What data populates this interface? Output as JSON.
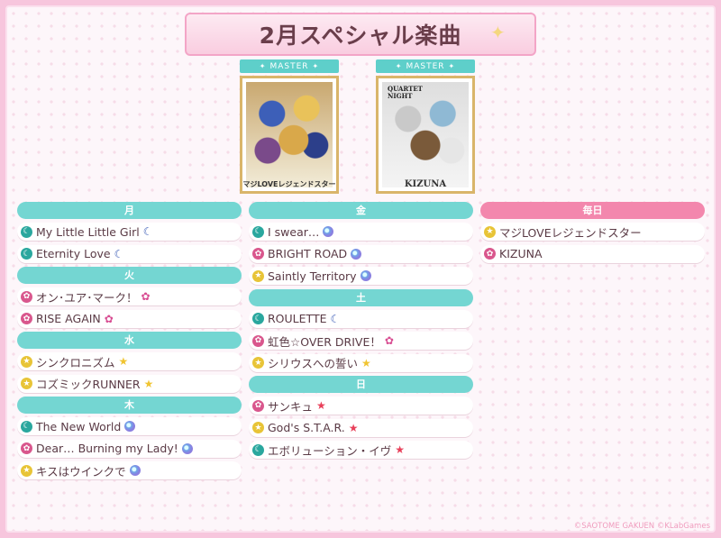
{
  "title": "2月スペシャル楽曲",
  "jackets": [
    {
      "badge": "MASTER",
      "caption": "マジLOVEレジェンドスター"
    },
    {
      "badge": "MASTER",
      "caption": "KIZUNA",
      "logo_line1": "QUARTET",
      "logo_line2": "NIGHT"
    }
  ],
  "columns": [
    {
      "groups": [
        {
          "day": "月",
          "songs": [
            {
              "name": "My Little Little Girl",
              "attr": "moon",
              "mark": "moon"
            },
            {
              "name": "Eternity Love",
              "attr": "moon",
              "mark": "moon"
            }
          ]
        },
        {
          "day": "火",
          "songs": [
            {
              "name": "オン･ユア･マーク！",
              "attr": "flower",
              "mark": "flower"
            },
            {
              "name": "RISE AGAIN",
              "attr": "flower",
              "mark": "flower"
            }
          ]
        },
        {
          "day": "水",
          "songs": [
            {
              "name": "シンクロニズム",
              "attr": "star",
              "mark": "star"
            },
            {
              "name": "コズミックRUNNER",
              "attr": "star",
              "mark": "star"
            }
          ]
        },
        {
          "day": "木",
          "songs": [
            {
              "name": "The New World",
              "attr": "moon",
              "mark": "rainbow"
            },
            {
              "name": "Dear… Burning my Lady!",
              "attr": "flower",
              "mark": "rainbow"
            },
            {
              "name": "キスはウインクで",
              "attr": "star",
              "mark": "rainbow"
            }
          ]
        }
      ]
    },
    {
      "groups": [
        {
          "day": "金",
          "songs": [
            {
              "name": "I swear…",
              "attr": "moon",
              "mark": "rainbow"
            },
            {
              "name": "BRIGHT ROAD",
              "attr": "flower",
              "mark": "rainbow"
            },
            {
              "name": "Saintly Territory",
              "attr": "star",
              "mark": "rainbow"
            }
          ]
        },
        {
          "day": "土",
          "songs": [
            {
              "name": "ROULETTE",
              "attr": "moon",
              "mark": "moon"
            },
            {
              "name": "虹色☆OVER DRIVE！",
              "attr": "flower",
              "mark": "flower"
            },
            {
              "name": "シリウスへの誓い",
              "attr": "star",
              "mark": "star"
            }
          ]
        },
        {
          "day": "日",
          "songs": [
            {
              "name": "サンキュ",
              "attr": "flower",
              "mark": "redstar"
            },
            {
              "name": "God's S.T.A.R.",
              "attr": "star",
              "mark": "redstar"
            },
            {
              "name": "エボリューション・イヴ",
              "attr": "moon",
              "mark": "redstar"
            }
          ]
        }
      ]
    },
    {
      "groups": [
        {
          "day": "毎日",
          "pink": true,
          "songs": [
            {
              "name": "マジLOVEレジェンドスター",
              "attr": "star",
              "mark": ""
            },
            {
              "name": "KIZUNA",
              "attr": "flower",
              "mark": ""
            }
          ]
        }
      ]
    }
  ],
  "copyright": "©SAOTOME GAKUEN ©KLabGames",
  "colors": {
    "day_header": "#74d6d2",
    "everyday_header": "#f387ad",
    "moon": "#2aa79e",
    "flower": "#d9578d",
    "star": "#e8c437",
    "title_text": "#6a3e4b"
  }
}
